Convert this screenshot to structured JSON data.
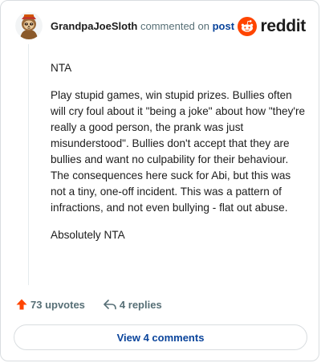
{
  "header": {
    "username": "GrandpaJoeSloth",
    "action_text": "commented on",
    "target_link": "post",
    "brand_name": "reddit"
  },
  "comment": {
    "paragraphs": [
      "NTA",
      "Play stupid games, win stupid prizes. Bullies often will cry foul about it \"being a joke\" about how \"they're really a good person, the prank was just misunderstood\". Bullies don't accept that they are bullies and want no culpability for their behaviour. The consequences here suck for Abi, but this was not a tiny, one-off incident. This was a pattern of infractions, and not even bullying - flat out abuse.",
      "Absolutely NTA"
    ]
  },
  "actions": {
    "upvotes_label": "73 upvotes",
    "replies_label": "4 replies"
  },
  "footer": {
    "view_comments_label": "View 4 comments"
  },
  "colors": {
    "accent_orange": "#ff4500",
    "link_blue": "#0a449b",
    "meta_gray": "#576f76"
  },
  "icons": {
    "avatar": "sloth-avatar-icon",
    "brand": "reddit-snoo-icon",
    "upvote": "upvote-arrow-icon",
    "reply": "reply-arrow-icon"
  }
}
